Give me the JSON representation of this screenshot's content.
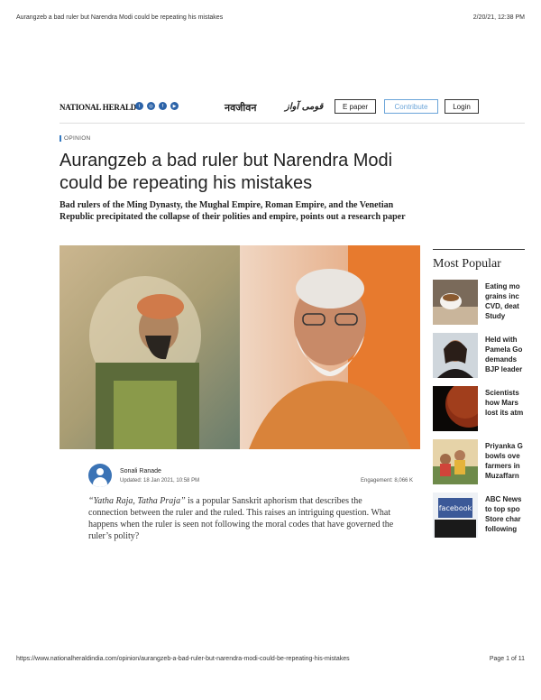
{
  "print": {
    "header_title": "Aurangzeb a bad ruler but Narendra Modi could be repeating his mistakes",
    "header_date": "2/20/21, 12:38 PM",
    "footer_url": "https://www.nationalheraldindia.com/opinion/aurangzeb-a-bad-ruler-but-narendra-modi-could-be-repeating-his-mistakes",
    "footer_page": "Page 1 of 11"
  },
  "nav": {
    "brand": "NATIONAL HERALD",
    "social_icons": [
      "twitter-icon",
      "instagram-icon",
      "facebook-icon",
      "youtube-icon"
    ],
    "navjivan": "नवजीवन",
    "qaumi": "قومی آواز",
    "epaper_label": "E paper",
    "contribute_label": "Contribute",
    "login_label": "Login"
  },
  "article": {
    "section": "OPINION",
    "title": "Aurangzeb a bad ruler but Narendra Modi could be repeating his mistakes",
    "subtitle": "Bad rulers of the Ming Dynasty, the Mughal Empire, Roman Empire, and the Venetian Republic precipitated the collapse of their polities and empire, points out a research paper",
    "author": "Sonali Ranade",
    "updated": "Updated: 18 Jan 2021, 10:58 PM",
    "engagement": "Engagement: 8,066 K",
    "body_quote": "“Yatha Raja, Tatha Praja”",
    "body_rest": " is a popular Sanskrit aphorism that describes the connection between the ruler and the ruled.  This raises an intriguing question.  What happens when the ruler is seen not following the moral codes that have governed the ruler’s polity?"
  },
  "sidebar": {
    "heading": "Most Popular",
    "items": [
      {
        "text": "Eating mo\ngrains inc\nCVD, deat\nStudy",
        "thumb": "tea-cup-image"
      },
      {
        "text": "Held with\nPamela Go\ndemands\nBJP leader",
        "thumb": "woman-portrait-image"
      },
      {
        "text": "Scientists\nhow Mars\nlost its atm",
        "thumb": "mars-image"
      },
      {
        "text": "Priyanka G\nbowls ove\nfarmers in\nMuzaffarn",
        "thumb": "rally-image"
      },
      {
        "text": "ABC News\nto top spo\nStore char\nfollowing",
        "thumb": "facebook-sign-image"
      }
    ]
  },
  "colors": {
    "accent": "#3579c0",
    "saffron": "#e36a22"
  }
}
